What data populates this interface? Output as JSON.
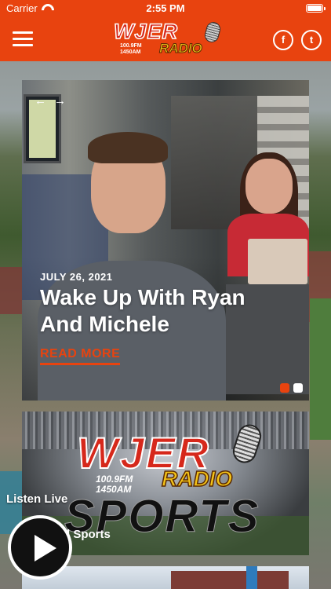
{
  "status_bar": {
    "carrier": "Carrier",
    "time": "2:55 PM"
  },
  "header": {
    "logo": {
      "call_letters": "WJER",
      "freq_fm": "100.9FM",
      "freq_am": "1450AM",
      "radio_word": "RADIO"
    },
    "menu_icon": "hamburger-icon",
    "social": {
      "facebook": "f",
      "twitter": "t"
    }
  },
  "hero": {
    "date": "JULY 26, 2021",
    "title": "Wake Up With Ryan And Michele",
    "read_more": "READ MORE",
    "prev_arrow": "←",
    "next_arrow": "→"
  },
  "sports_card": {
    "brand": "WJER",
    "freq_fm": "100.9FM",
    "freq_am": "1450AM",
    "radio_word": "RADIO",
    "sports_word": "SPORTS",
    "label": "Local Sports"
  },
  "player": {
    "label": "Listen Live",
    "play_icon": "play-icon"
  },
  "colors": {
    "accent": "#e8430f",
    "white": "#ffffff"
  }
}
